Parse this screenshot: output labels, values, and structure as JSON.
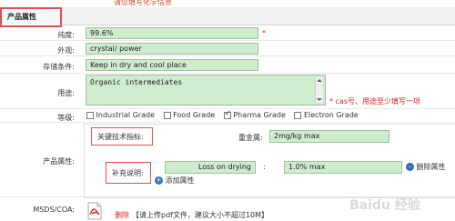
{
  "top_hint": "请您填写化学信息",
  "section_title": "产品属性",
  "fields": {
    "purity": {
      "label": "纯度:",
      "value": "99.6%",
      "required": "*"
    },
    "appearance": {
      "label": "外观:",
      "value": "crystal/ power"
    },
    "storage": {
      "label": "存储条件:",
      "value": "Keep in dry and cool place"
    },
    "usage": {
      "label": "用途:",
      "value": "Organic intermediates",
      "note": "* cas号、用途至少填写一项"
    }
  },
  "grade": {
    "label": "等级:",
    "options": [
      {
        "label": "Industrial Grade",
        "checked": false
      },
      {
        "label": "Food Grade",
        "checked": false
      },
      {
        "label": "Pharma Grade",
        "checked": true
      },
      {
        "label": "Electron Grade",
        "checked": false
      }
    ]
  },
  "product_props": {
    "label": "产品属性:",
    "key_indicator_label": "关键技术指标:",
    "weight_label": "重金属:",
    "weight_value": "2mg/kg max",
    "supplement_label": "补充说明:",
    "supp_name": "Loss on drying",
    "supp_colon": ":",
    "supp_value": "1.0% max",
    "delete_label": "删除属性",
    "add_label": "添加属性",
    "delete_icon": "minus-circle-icon",
    "add_icon": "plus-circle-icon"
  },
  "msds": {
    "label": "MSDS/COA:",
    "icon": "pdf-file-icon",
    "delete_label": "删除",
    "note": "【请上传pdf文件，建议大小不超过10M】"
  },
  "watermark": "Baidu 经验"
}
